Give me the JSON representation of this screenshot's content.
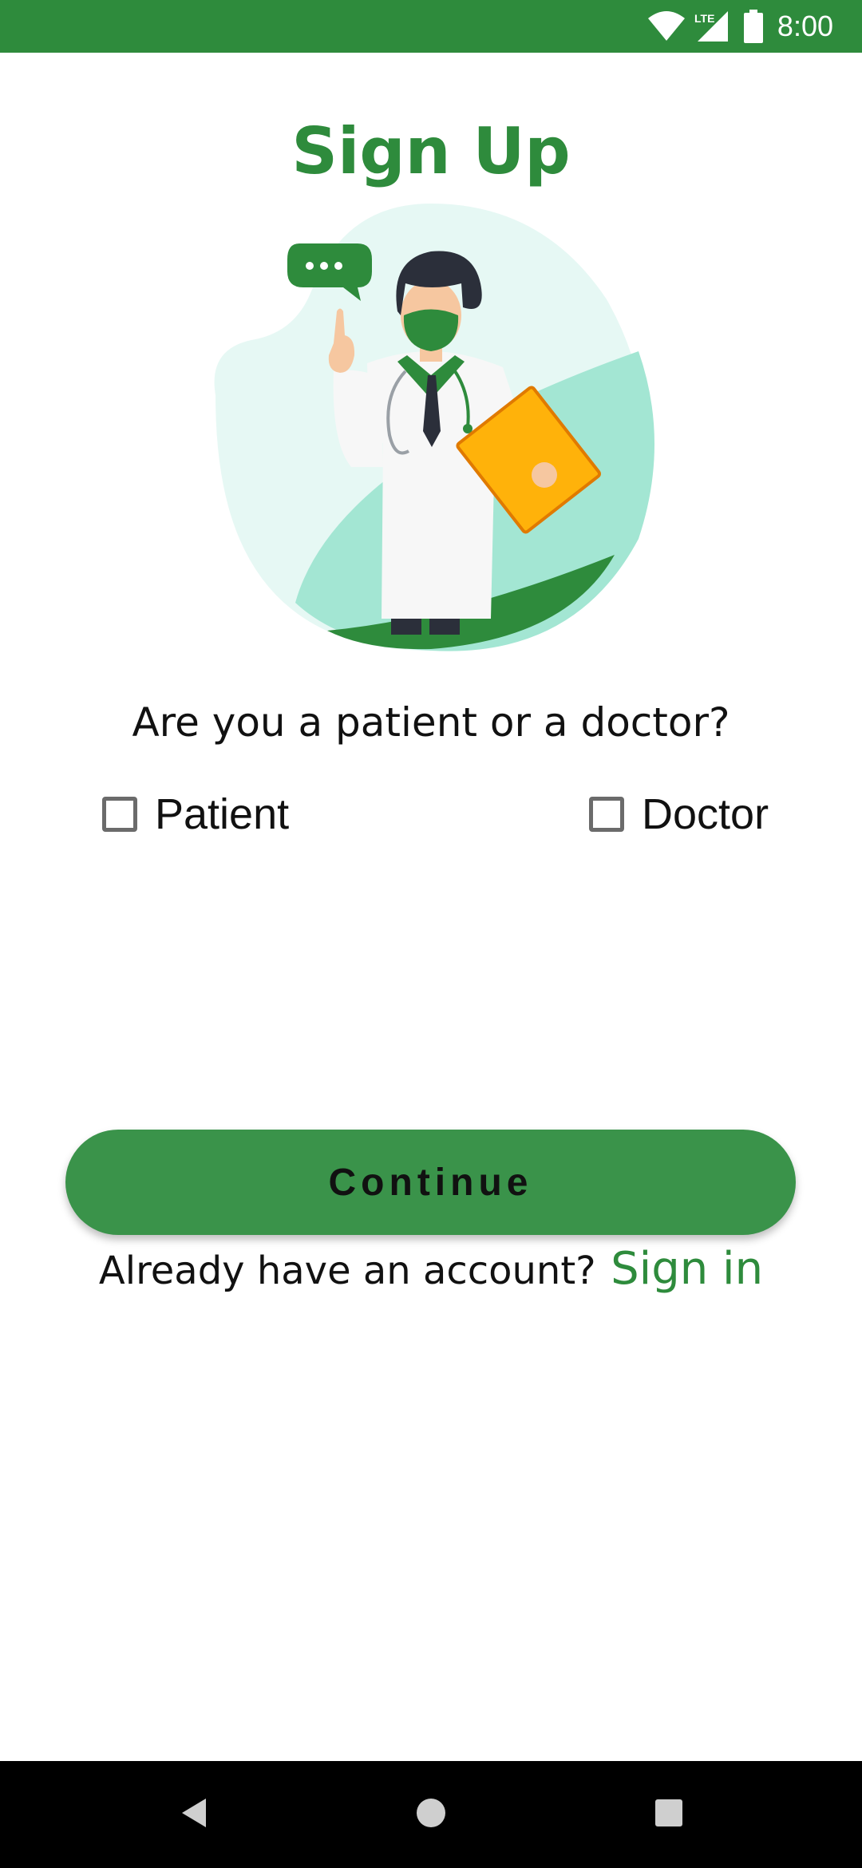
{
  "status_bar": {
    "time": "8:00",
    "icons": [
      "wifi-icon",
      "lte-signal-icon",
      "battery-icon"
    ],
    "network_label": "LTE",
    "background_color": "#2e8b3c"
  },
  "page": {
    "title": "Sign Up",
    "question": "Are you a patient or a doctor?"
  },
  "roles": [
    {
      "label": "Patient",
      "checked": false
    },
    {
      "label": "Doctor",
      "checked": false
    }
  ],
  "actions": {
    "continue_label": "Continue",
    "signin_prompt": "Already have an account?",
    "signin_link": "Sign in"
  },
  "nav_bar": {
    "icons": [
      "back-icon",
      "home-icon",
      "recents-icon"
    ]
  },
  "colors": {
    "accent": "#2e8b3c",
    "button": "#3a934a",
    "text": "#111111"
  }
}
